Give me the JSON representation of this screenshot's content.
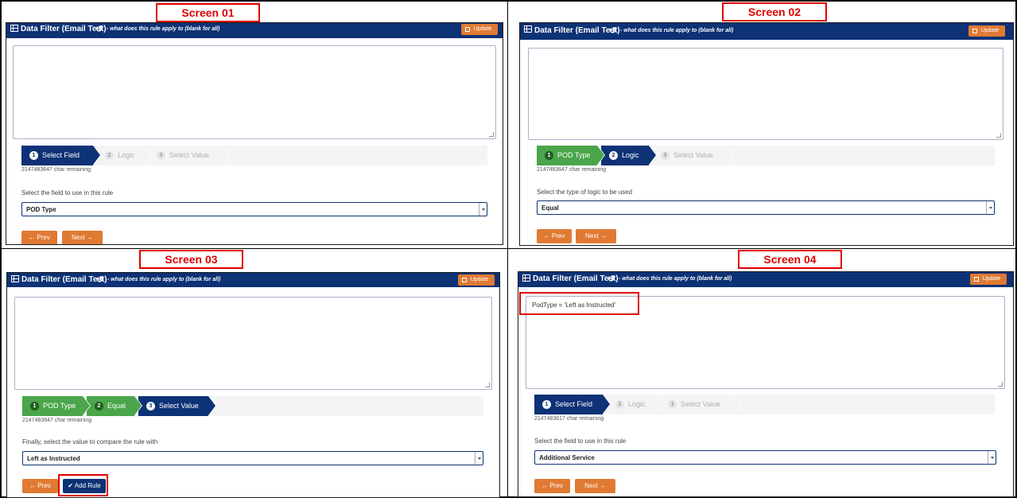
{
  "screens": [
    {
      "label": "Screen 01",
      "header": {
        "title": "Data Filter (Email Test)",
        "reset_icon": "↺",
        "subtitle": "- what does this rule apply to (blank for all)",
        "update_label": "Update"
      },
      "rule_text": "",
      "steps": [
        {
          "num": "1",
          "label": "Select Field",
          "state": "active"
        },
        {
          "num": "2",
          "label": "Logic",
          "state": "todo"
        },
        {
          "num": "3",
          "label": "Select Value",
          "state": "todo"
        }
      ],
      "chars_remaining": "2147483647 char remaining",
      "prompt": "Select the field to use in this rule",
      "select_value": "POD Type",
      "buttons": {
        "prev": "Prev",
        "next": "Next"
      }
    },
    {
      "label": "Screen 02",
      "header": {
        "title": "Data Filter (Email Test)",
        "reset_icon": "↺",
        "subtitle": "- what does this rule apply to (blank for all)",
        "update_label": "Update"
      },
      "rule_text": "",
      "steps": [
        {
          "num": "1",
          "label": "POD Type",
          "state": "done"
        },
        {
          "num": "2",
          "label": "Logic",
          "state": "active"
        },
        {
          "num": "3",
          "label": "Select Value",
          "state": "todo"
        }
      ],
      "chars_remaining": "2147483647 char remaining",
      "prompt": "Select the type of logic to be used",
      "select_value": "Equal",
      "buttons": {
        "prev": "Prev",
        "next": "Next"
      }
    },
    {
      "label": "Screen 03",
      "header": {
        "title": "Data Filter (Email Test)",
        "reset_icon": "↺",
        "subtitle": "- what does this rule apply to (blank for all)",
        "update_label": "Update"
      },
      "rule_text": "",
      "steps": [
        {
          "num": "1",
          "label": "POD Type",
          "state": "done"
        },
        {
          "num": "2",
          "label": "Equal",
          "state": "done"
        },
        {
          "num": "3",
          "label": "Select Value",
          "state": "active"
        }
      ],
      "chars_remaining": "2147483647 char remaining",
      "prompt": "Finally, select the value to compare the rule with",
      "select_value": "Left as Instructed",
      "buttons": {
        "prev": "Prev",
        "add_rule": "Add Rule"
      }
    },
    {
      "label": "Screen 04",
      "header": {
        "title": "Data Filter (Email Test)",
        "reset_icon": "↺",
        "subtitle": "- what does this rule apply to (blank for all)",
        "update_label": "Update"
      },
      "rule_text": "PodType = 'Left as Instructed'",
      "steps": [
        {
          "num": "1",
          "label": "Select Field",
          "state": "active"
        },
        {
          "num": "2",
          "label": "Logic",
          "state": "todo"
        },
        {
          "num": "3",
          "label": "Select Value",
          "state": "todo"
        }
      ],
      "chars_remaining": "2147483617 char remaining",
      "prompt": "Select the field to use in this rule",
      "select_value": "Additional Service",
      "buttons": {
        "prev": "Prev",
        "next": "Next"
      }
    }
  ],
  "colors": {
    "header": "#0d3275",
    "orange": "#e07a33",
    "green": "#4aa54b",
    "highlight": "#e00000"
  },
  "icons": {
    "table": "table-icon",
    "reset": "reset-icon",
    "save": "save-icon",
    "prev": "arrow-left-icon",
    "next": "arrow-right-icon",
    "add": "check-circle-icon"
  }
}
